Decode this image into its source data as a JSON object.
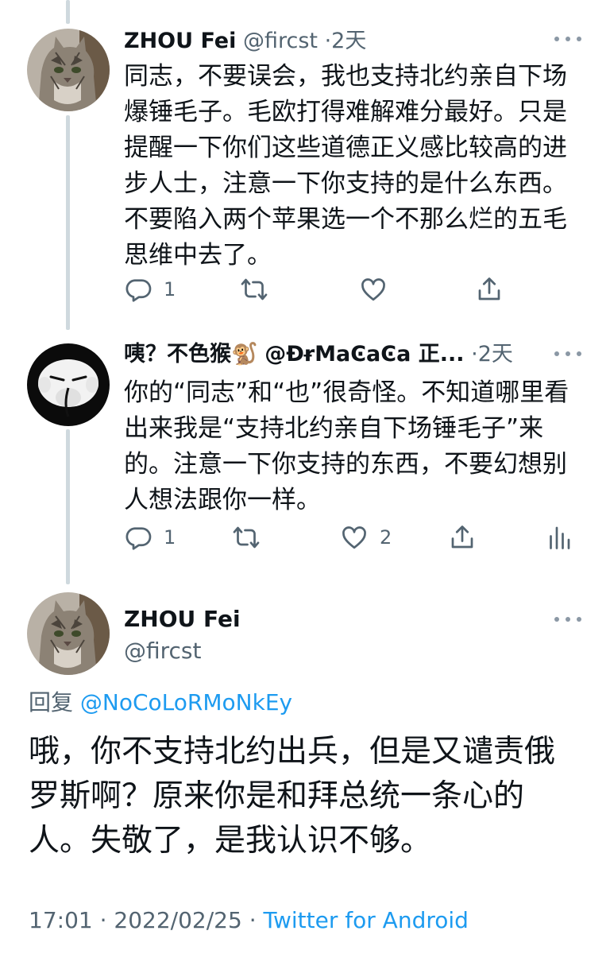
{
  "tweets": [
    {
      "author_name": "ZHOU Fei",
      "handle": "@fircst",
      "separator": "·",
      "time": "2天",
      "text": "同志，不要误会，我也支持北约亲自下场爆锤毛子。毛欧打得难解难分最好。只是提醒一下你们这些道德正义感比较高的进步人士，注意一下你支持的是什么东西。不要陷入两个苹果选一个不那么烂的五毛思维中去了。",
      "reply_count": "1",
      "retweet_count": "",
      "like_count": ""
    },
    {
      "author_name": "咦？不色猴🐒",
      "handle": "@ÐɍMaϾaϾa 正...",
      "separator": "·",
      "time": "2天",
      "text": "你的“同志”和“也”很奇怪。不知道哪里看出来我是“支持北约亲自下场锤毛子”来的。注意一下你支持的东西，不要幻想别人想法跟你一样。",
      "reply_count": "1",
      "retweet_count": "",
      "like_count": "2"
    }
  ],
  "main_tweet": {
    "author_name": "ZHOU Fei",
    "handle": "@fircst",
    "reply_prefix": "回复",
    "reply_to": "@NoCoLoRMoNkEy",
    "text": "哦，你不支持北约出兵，但是又谴责俄罗斯啊？原来你是和拜总统一条心的人。失敬了，是我认识不够。",
    "time": "17:01",
    "date": "2022/02/25",
    "separator": "·",
    "source": "Twitter for Android"
  },
  "colors": {
    "text": "#0f1419",
    "muted": "#536471",
    "link": "#1d9bf0",
    "thread_line": "#cfd9de"
  },
  "icons": [
    "reply-icon",
    "retweet-icon",
    "like-icon",
    "share-icon",
    "analytics-icon",
    "more-icon"
  ]
}
